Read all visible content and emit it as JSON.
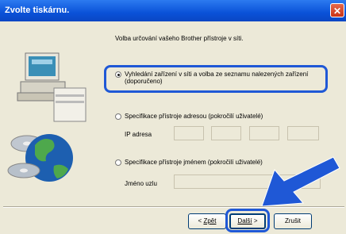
{
  "window": {
    "title": "Zvolte tiskárnu.",
    "close_glyph": "✕"
  },
  "main": {
    "heading": "Volba určování vašeho Brother přístroje v síti.",
    "option_search": {
      "line1": "Vyhledání zařízení v síti a volba ze seznamu nalezených zařízení",
      "line2": "(doporučeno)",
      "selected": true
    },
    "option_address": {
      "label": "Specifikace přístroje adresou (pokročilí uživatelé)",
      "selected": false
    },
    "ip_label": "IP adresa",
    "option_name": {
      "label": "Specifikace přístroje jménem (pokročilí uživatelé)",
      "selected": false
    },
    "node_label": "Jméno uzlu"
  },
  "buttons": {
    "back_prefix": "< ",
    "back_label": "Zpět",
    "next_label": "Další",
    "next_suffix": " >",
    "cancel_label": "Zrušit"
  },
  "colors": {
    "highlight": "#1f58d6",
    "arrow": "#1f58d6"
  }
}
